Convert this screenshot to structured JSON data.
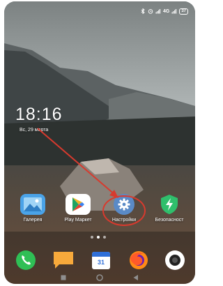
{
  "status_bar": {
    "signal": "4G",
    "battery": "37"
  },
  "lock": {
    "time": "18:16",
    "date": "Вс, 29 марта"
  },
  "apps": [
    {
      "name": "gallery-app",
      "label": "Галерея",
      "icon": "gallery-icon"
    },
    {
      "name": "play-market-app",
      "label": "Play Маркет",
      "icon": "play-store-icon"
    },
    {
      "name": "settings-app",
      "label": "Настройки",
      "icon": "gear-icon"
    },
    {
      "name": "security-app",
      "label": "Безопасност",
      "icon": "security-bolt-icon"
    }
  ],
  "dock": [
    {
      "name": "phone-app",
      "icon": "phone-icon"
    },
    {
      "name": "messages-app",
      "icon": "message-icon"
    },
    {
      "name": "calendar-app",
      "icon": "calendar-icon",
      "label": "31"
    },
    {
      "name": "firefox-app",
      "icon": "firefox-icon"
    },
    {
      "name": "camera-app",
      "icon": "camera-icon"
    }
  ],
  "page_indicator": {
    "pages": 3,
    "current": 2
  },
  "colors": {
    "annotation": "#d83a2e",
    "phone_green": "#2fbf55",
    "message_orange": "#f7a93b",
    "security_green": "#2fbf6c",
    "settings_blue": "#5a8ac6"
  }
}
